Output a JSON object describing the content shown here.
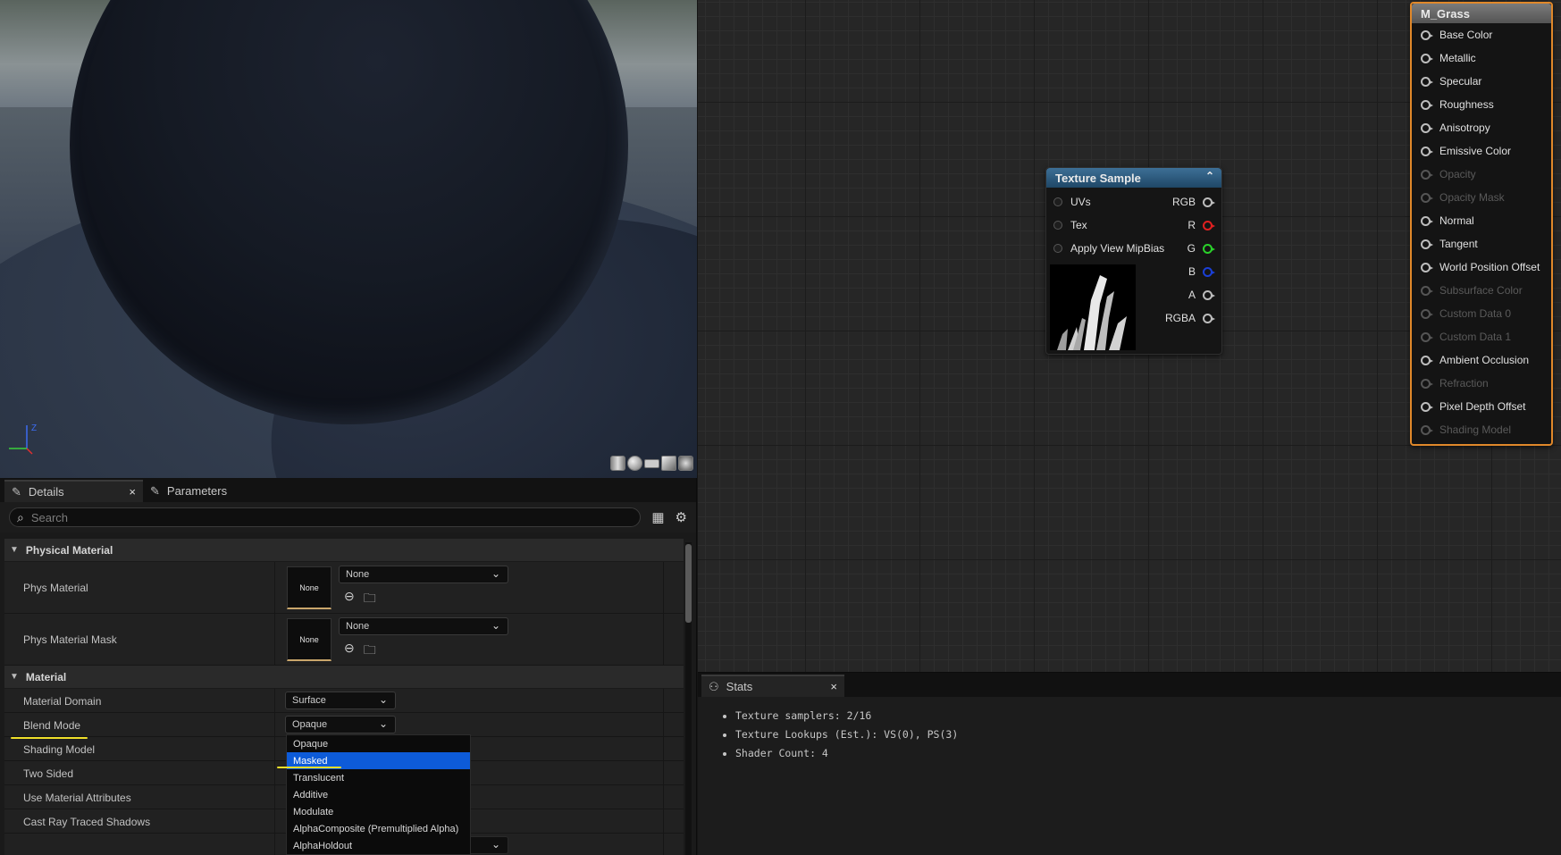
{
  "viewport": {
    "axis": {
      "z_label": "Z"
    },
    "preview_buttons": [
      "cylinder-preview",
      "sphere-preview",
      "plane-preview",
      "cube-preview",
      "custom-mesh-preview"
    ]
  },
  "details": {
    "tabs": [
      {
        "label": "Details",
        "icon": "pencil-icon",
        "close": "×"
      },
      {
        "label": "Parameters",
        "icon": "pencil-icon"
      }
    ],
    "search_placeholder": "Search",
    "categories": {
      "physical": {
        "label": "Physical Material",
        "phys_material": {
          "label": "Phys Material",
          "thumb": "None",
          "value": "None"
        },
        "phys_material_mask": {
          "label": "Phys Material Mask",
          "thumb": "None",
          "value": "None"
        }
      },
      "material": {
        "label": "Material",
        "material_domain": {
          "label": "Material Domain",
          "value": "Surface"
        },
        "blend_mode": {
          "label": "Blend Mode",
          "value": "Opaque"
        },
        "shading_model": {
          "label": "Shading Model"
        },
        "two_sided": {
          "label": "Two Sided"
        },
        "use_material_attributes": {
          "label": "Use Material Attributes"
        },
        "cast_ray_traced_shadows": {
          "label": "Cast Ray Traced Shadows"
        }
      }
    },
    "blend_mode_options": [
      "Opaque",
      "Masked",
      "Translucent",
      "Additive",
      "Modulate",
      "AlphaComposite (Premultiplied Alpha)",
      "AlphaHoldout"
    ],
    "selected_option": "Masked",
    "annotation_color": "#f0e02a"
  },
  "graph": {
    "texture_node": {
      "title": "Texture Sample",
      "inputs": [
        "UVs",
        "Tex",
        "Apply View MipBias"
      ],
      "outputs": [
        {
          "label": "RGB",
          "color": "#bdbdbd"
        },
        {
          "label": "R",
          "color": "#e02020"
        },
        {
          "label": "G",
          "color": "#2ad12a"
        },
        {
          "label": "B",
          "color": "#1a3fd6"
        },
        {
          "label": "A",
          "color": "#bdbdbd"
        },
        {
          "label": "RGBA",
          "color": "#bdbdbd"
        }
      ]
    },
    "result_node": {
      "title": "M_Grass",
      "pins": [
        {
          "label": "Base Color",
          "enabled": true
        },
        {
          "label": "Metallic",
          "enabled": true
        },
        {
          "label": "Specular",
          "enabled": true
        },
        {
          "label": "Roughness",
          "enabled": true
        },
        {
          "label": "Anisotropy",
          "enabled": true
        },
        {
          "label": "Emissive Color",
          "enabled": true
        },
        {
          "label": "Opacity",
          "enabled": false
        },
        {
          "label": "Opacity Mask",
          "enabled": false
        },
        {
          "label": "Normal",
          "enabled": true
        },
        {
          "label": "Tangent",
          "enabled": true
        },
        {
          "label": "World Position Offset",
          "enabled": true
        },
        {
          "label": "Subsurface Color",
          "enabled": false
        },
        {
          "label": "Custom Data 0",
          "enabled": false
        },
        {
          "label": "Custom Data 1",
          "enabled": false
        },
        {
          "label": "Ambient Occlusion",
          "enabled": true
        },
        {
          "label": "Refraction",
          "enabled": false
        },
        {
          "label": "Pixel Depth Offset",
          "enabled": true
        },
        {
          "label": "Shading Model",
          "enabled": false
        }
      ]
    }
  },
  "stats": {
    "tab": {
      "label": "Stats",
      "icon": "stats-icon",
      "close": "×"
    },
    "lines": [
      "Texture samplers: 2/16",
      "Texture Lookups (Est.): VS(0), PS(3)",
      "Shader Count: 4"
    ]
  }
}
